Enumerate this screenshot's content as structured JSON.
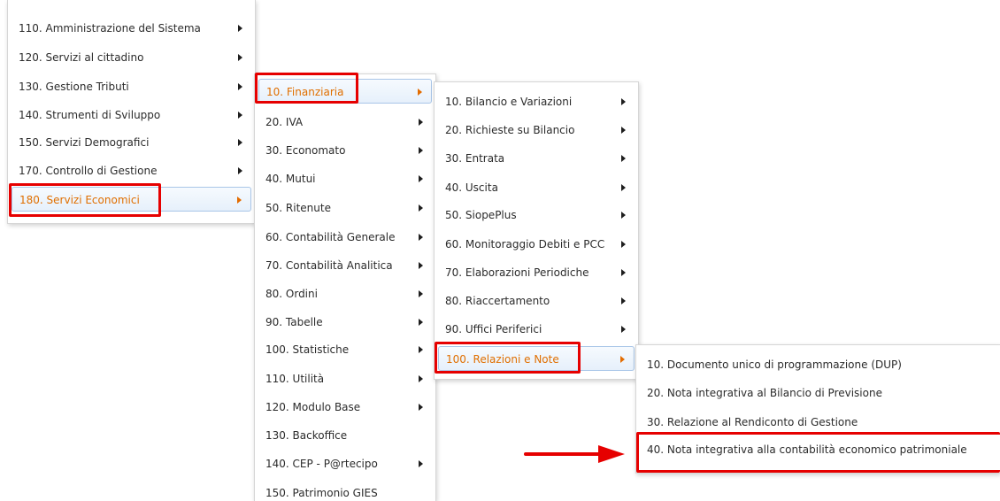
{
  "menu_level_1": {
    "items": [
      {
        "label": "110. Amministrazione del Sistema"
      },
      {
        "label": "120. Servizi al cittadino"
      },
      {
        "label": "130. Gestione Tributi"
      },
      {
        "label": "140. Strumenti di Sviluppo"
      },
      {
        "label": "150. Servizi Demografici"
      },
      {
        "label": "170. Controllo di Gestione"
      },
      {
        "label": "180. Servizi Economici"
      }
    ]
  },
  "menu_level_2": {
    "items": [
      {
        "label": "10. Finanziaria"
      },
      {
        "label": "20. IVA"
      },
      {
        "label": "30. Economato"
      },
      {
        "label": "40. Mutui"
      },
      {
        "label": "50. Ritenute"
      },
      {
        "label": "60. Contabilità Generale"
      },
      {
        "label": "70. Contabilità Analitica"
      },
      {
        "label": "80. Ordini"
      },
      {
        "label": "90. Tabelle"
      },
      {
        "label": "100. Statistiche"
      },
      {
        "label": "110. Utilità"
      },
      {
        "label": "120. Modulo Base"
      },
      {
        "label": "130. Backoffice"
      },
      {
        "label": "140. CEP - P@rtecipo"
      },
      {
        "label": "150. Patrimonio GIES"
      }
    ]
  },
  "menu_level_3": {
    "items": [
      {
        "label": "10. Bilancio e Variazioni"
      },
      {
        "label": "20. Richieste su Bilancio"
      },
      {
        "label": "30. Entrata"
      },
      {
        "label": "40. Uscita"
      },
      {
        "label": "50. SiopePlus"
      },
      {
        "label": "60. Monitoraggio Debiti e PCC"
      },
      {
        "label": "70. Elaborazioni Periodiche"
      },
      {
        "label": "80. Riaccertamento"
      },
      {
        "label": "90. Uffici Periferici"
      },
      {
        "label": "100. Relazioni e Note"
      }
    ]
  },
  "menu_level_4": {
    "items": [
      {
        "label": "10. Documento unico di programmazione (DUP)"
      },
      {
        "label": "20. Nota integrativa al Bilancio di Previsione"
      },
      {
        "label": "30. Relazione al Rendiconto di Gestione"
      },
      {
        "label": "40. Nota integrativa alla contabilità economico patrimoniale"
      }
    ]
  },
  "colors": {
    "active_text": "#e06f00",
    "highlight_box": "#e60000",
    "active_background": "#e6f0fb"
  },
  "icons": {
    "submenu": "caret-right-icon",
    "pointer": "arrow-right-icon"
  }
}
